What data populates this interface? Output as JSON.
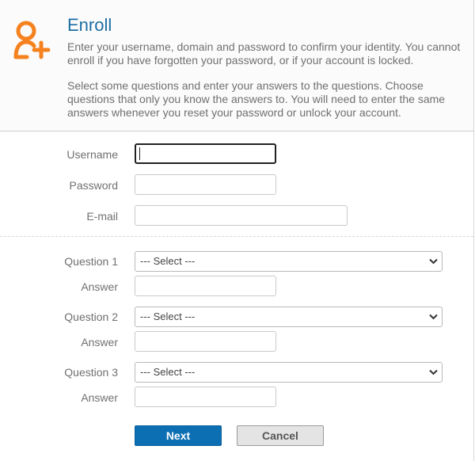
{
  "header": {
    "title": "Enroll",
    "description_1": "Enter your username, domain and password to confirm your identity. You cannot enroll if you have forgotten your password, or if your account is locked.",
    "description_2": "Select some questions and enter your answers to the questions. Choose questions that only you know the answers to. You will need to enter the same answers whenever you reset your password or unlock your account.",
    "icon": "add-user-icon",
    "accent_color": "#f5821f",
    "title_color": "#1c6ea4"
  },
  "form": {
    "username": {
      "label": "Username",
      "value": "",
      "placeholder": ""
    },
    "password": {
      "label": "Password",
      "value": "",
      "placeholder": ""
    },
    "email": {
      "label": "E-mail",
      "value": "",
      "placeholder": ""
    }
  },
  "questions": [
    {
      "label": "Question 1",
      "selected": "--- Select ---",
      "answer_label": "Answer",
      "answer_value": ""
    },
    {
      "label": "Question 2",
      "selected": "--- Select ---",
      "answer_label": "Answer",
      "answer_value": ""
    },
    {
      "label": "Question 3",
      "selected": "--- Select ---",
      "answer_label": "Answer",
      "answer_value": ""
    }
  ],
  "actions": {
    "next_label": "Next",
    "cancel_label": "Cancel",
    "next_color": "#0d6fb3"
  }
}
